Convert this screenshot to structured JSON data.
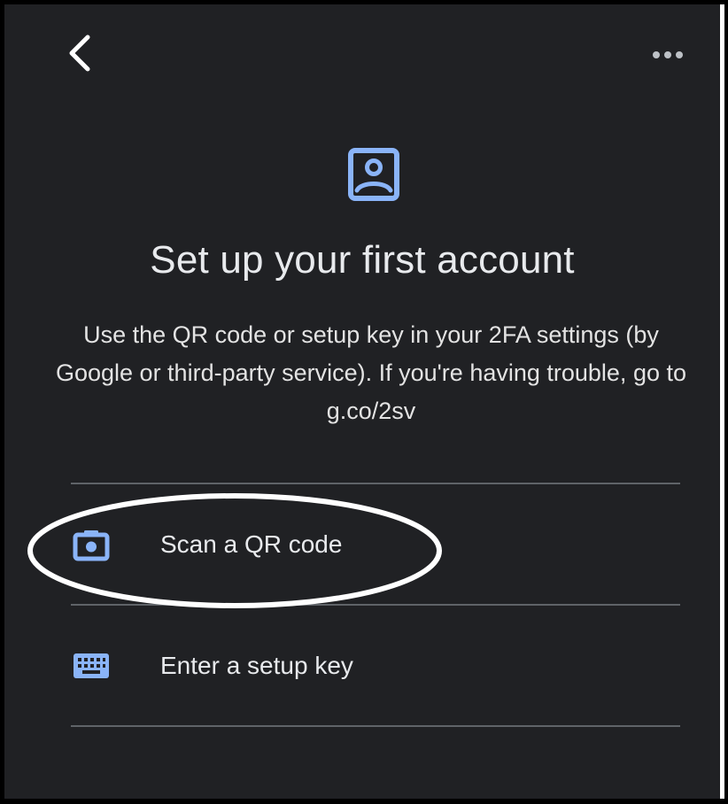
{
  "header": {
    "back_icon": "chevron-left-icon",
    "more_icon": "more-horizontal-icon"
  },
  "hero": {
    "icon": "account-box-icon",
    "title": "Set up your first account",
    "description": "Use the QR code or setup key in your 2FA settings (by Google or third-party service). If you're having trouble, go to g.co/2sv"
  },
  "options": [
    {
      "label": "Scan a QR code",
      "icon": "camera-icon",
      "highlighted": true
    },
    {
      "label": "Enter a setup key",
      "icon": "keyboard-icon",
      "highlighted": false
    }
  ],
  "colors": {
    "background": "#202124",
    "accent": "#8ab4f8",
    "text": "#e8eaed",
    "divider": "#5f6368",
    "annotation": "#ffffff"
  }
}
